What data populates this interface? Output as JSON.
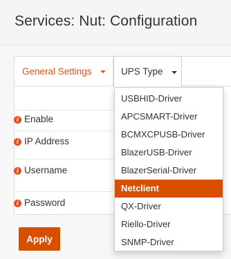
{
  "header": {
    "title": "Services: Nut: Configuration"
  },
  "tabs": [
    {
      "label": "General Settings",
      "active": false
    },
    {
      "label": "UPS Type",
      "active": true
    }
  ],
  "form": {
    "rows": [
      {
        "label": "Enable"
      },
      {
        "label": "IP Address"
      },
      {
        "label": "Username"
      },
      {
        "label": "Password"
      }
    ],
    "info_icon_glyph": "i"
  },
  "apply_button": {
    "label": "Apply"
  },
  "dropdown": {
    "items": [
      {
        "label": "USBHID-Driver"
      },
      {
        "label": "APCSMART-Driver"
      },
      {
        "label": "BCMXCPUSB-Driver"
      },
      {
        "label": "BlazerUSB-Driver"
      },
      {
        "label": "BlazerSerial-Driver"
      },
      {
        "label": "Netclient",
        "selected": true
      },
      {
        "label": "QX-Driver"
      },
      {
        "label": "Riello-Driver"
      },
      {
        "label": "SNMP-Driver"
      }
    ]
  },
  "colors": {
    "accent": "#d94f00",
    "tab_active_text": "#e0501b",
    "text": "#333333",
    "background": "#f7f7f7"
  }
}
